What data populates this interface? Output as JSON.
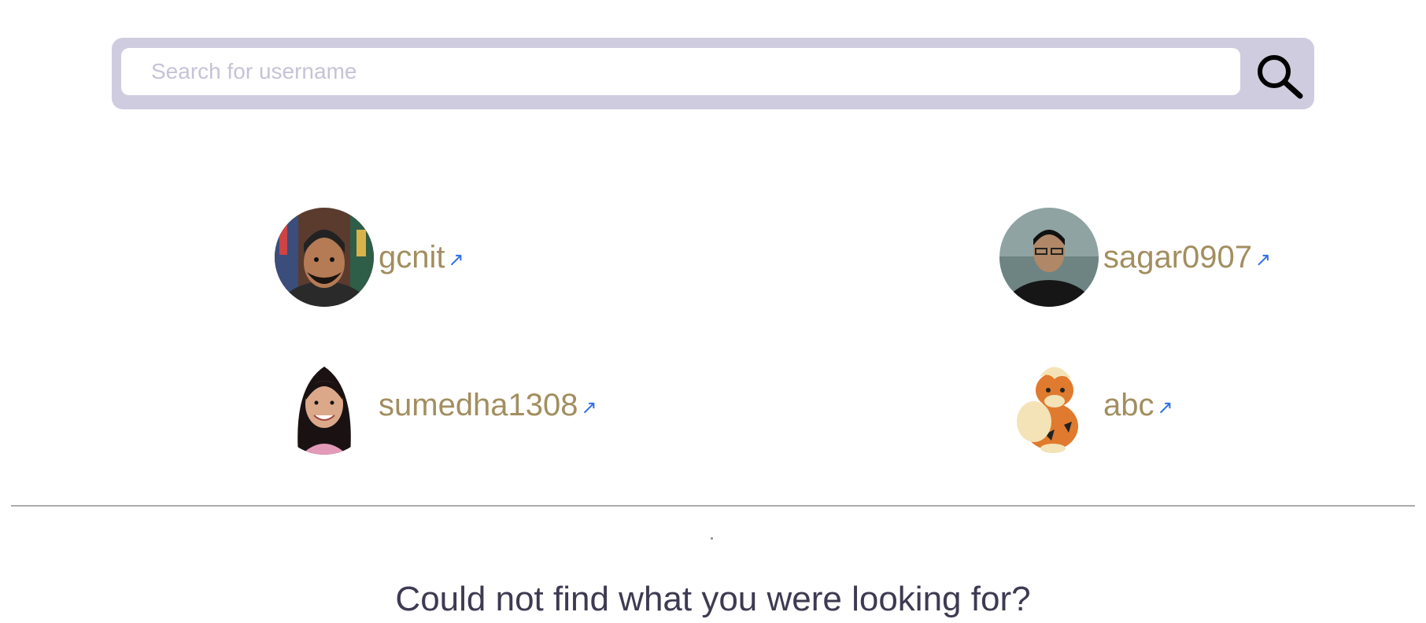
{
  "search": {
    "placeholder": "Search for username",
    "value": ""
  },
  "icons": {
    "search_button": "search-icon",
    "external_link": "arrow-up-right-icon"
  },
  "colors": {
    "search_bar_bg": "#d0ccdf",
    "username": "#a28e5f",
    "link_arrow": "#2f6fe8",
    "heading": "#3d3a52"
  },
  "users": [
    {
      "username": "gcnit",
      "arrow": "↗"
    },
    {
      "username": "sagar0907",
      "arrow": "↗"
    },
    {
      "username": "sumedha1308",
      "arrow": "↗"
    },
    {
      "username": "abc",
      "arrow": "↗"
    }
  ],
  "footer": {
    "heading": "Could not find what you were looking for?"
  }
}
